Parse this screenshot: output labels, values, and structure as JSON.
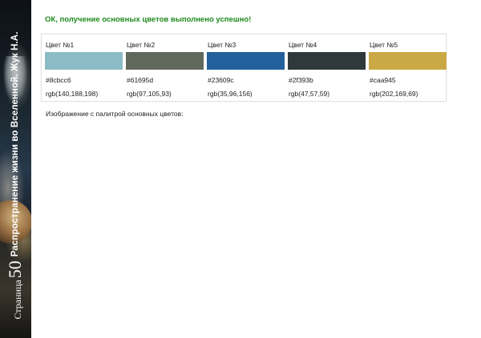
{
  "sidebar": {
    "title": "Распространение жизни во Вселенной. Жук Н.А.",
    "page_word": "Страница",
    "page_number": "50"
  },
  "status": {
    "message": "ОК, получение основных цветов выполнено успешно!",
    "color": "#1e8a1e"
  },
  "palette": [
    {
      "name": "Цвет №1",
      "hex": "#8cbcc6",
      "rgb": "rgb(140,188,198)"
    },
    {
      "name": "Цвет №2",
      "hex": "#61695d",
      "rgb": "rgb(97,105,93)"
    },
    {
      "name": "Цвет №3",
      "hex": "#23609c",
      "rgb": "rgb(35,96,156)"
    },
    {
      "name": "Цвет №4",
      "hex": "#2f393b",
      "rgb": "rgb(47,57,59)"
    },
    {
      "name": "Цвет №5",
      "hex": "#caa945",
      "rgb": "rgb(202,169,69)"
    }
  ],
  "caption": "Изображение с палитрой основных цветов:"
}
